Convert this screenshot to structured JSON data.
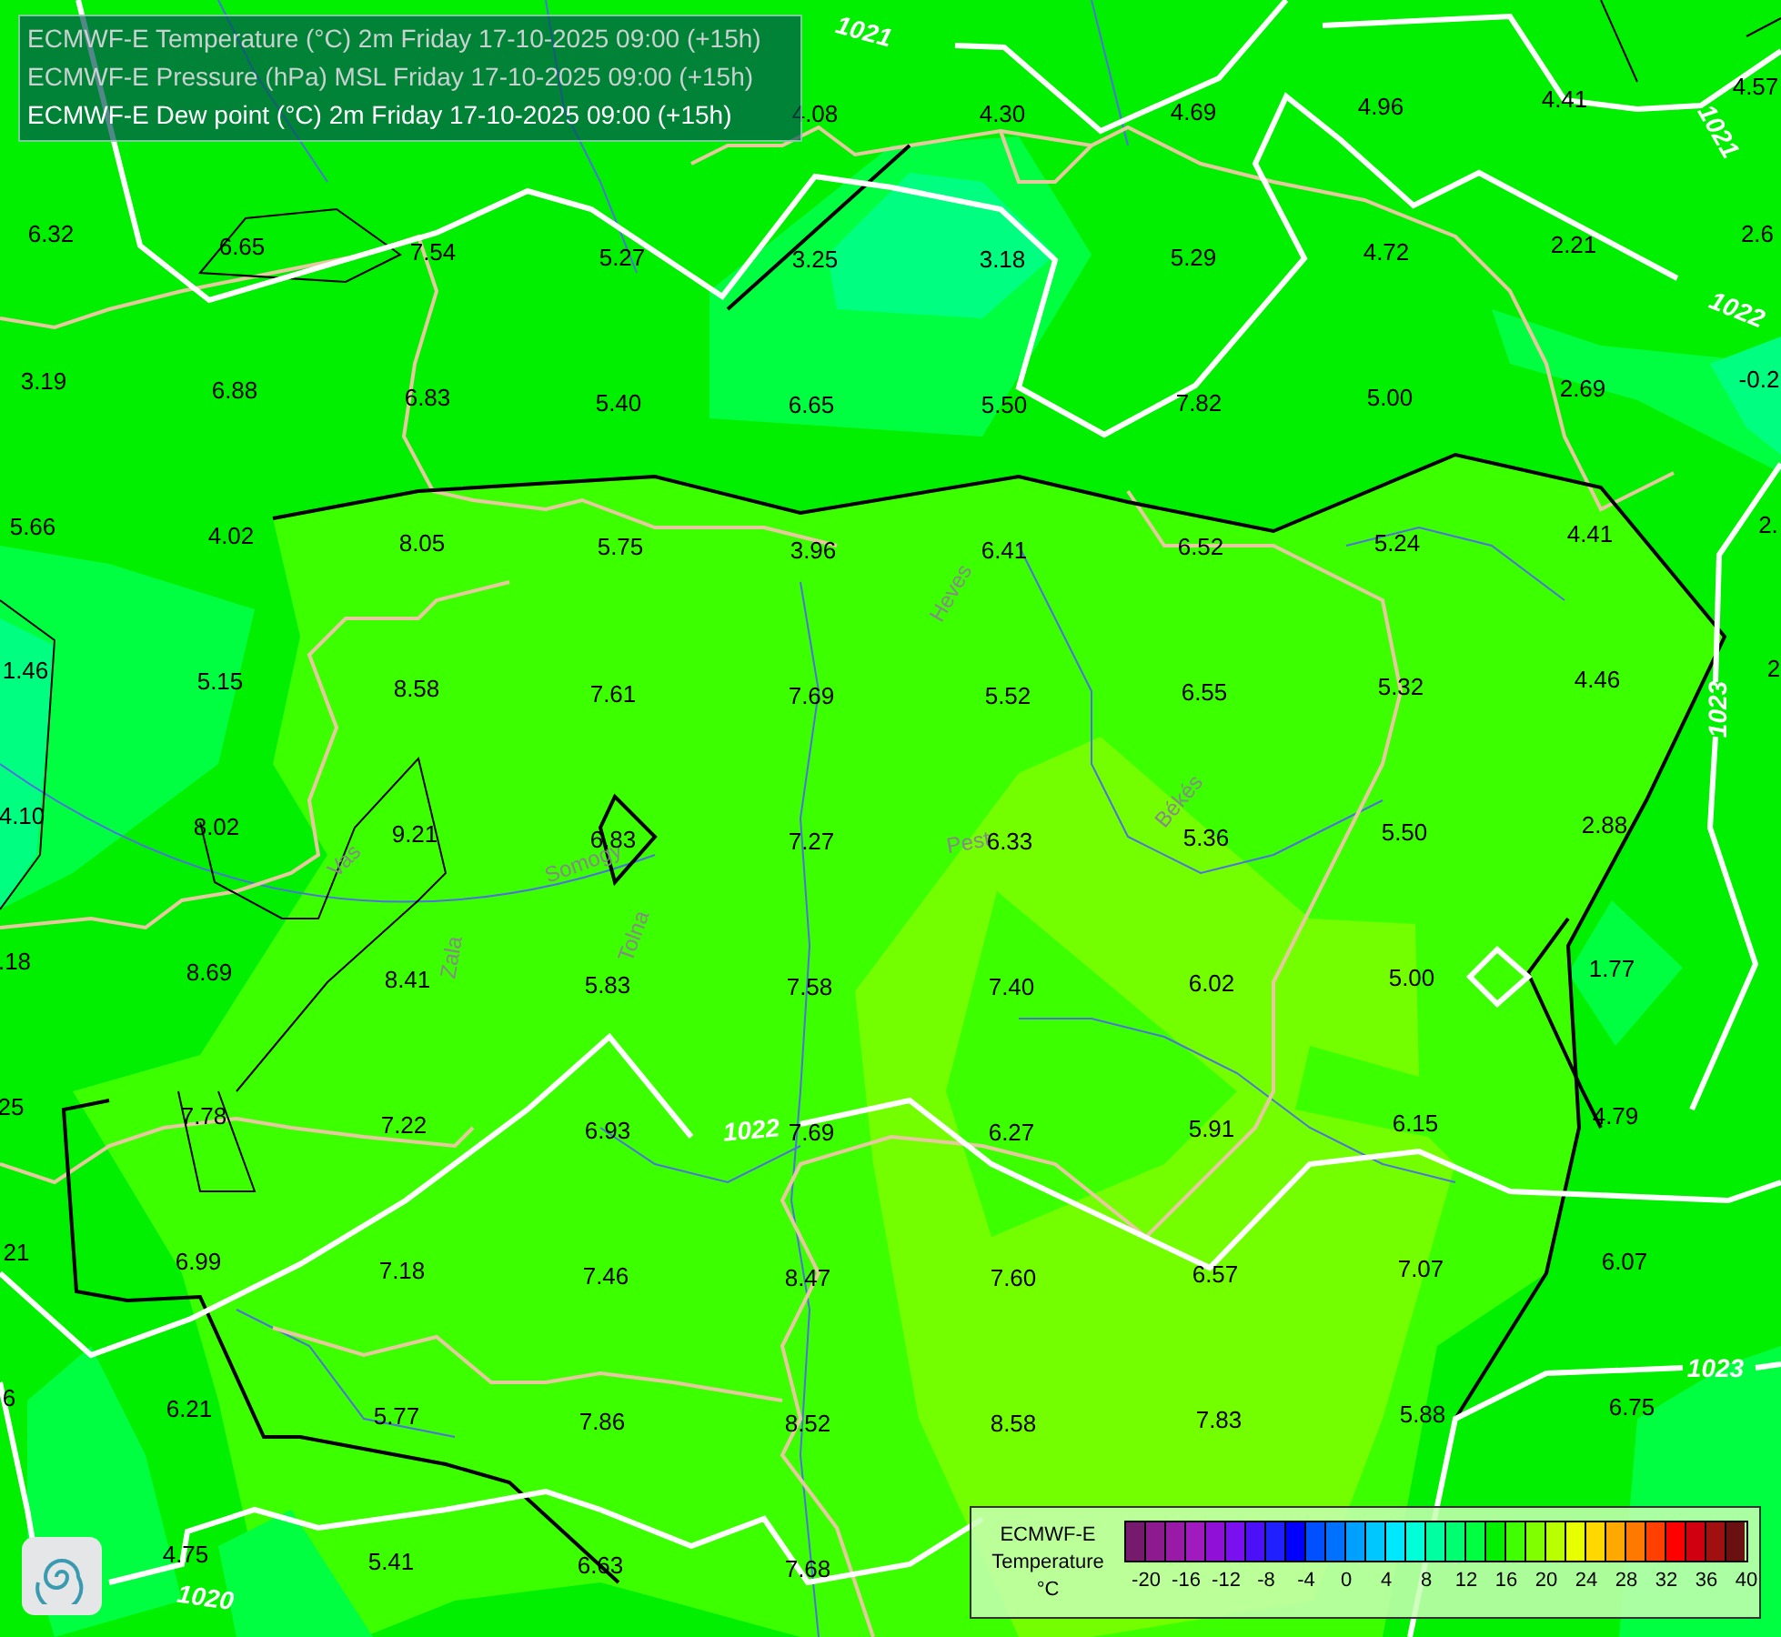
{
  "header": {
    "lines": [
      {
        "text": "ECMWF-E Temperature (°C) 2m Friday 17-10-2025 09:00 (+15h)",
        "selected": false
      },
      {
        "text": "ECMWF-E Pressure (hPa) MSL Friday 17-10-2025 09:00 (+15h)",
        "selected": false
      },
      {
        "text": "ECMWF-E Dew point (°C) 2m Friday 17-10-2025 09:00 (+15h)",
        "selected": true
      }
    ]
  },
  "values": [
    "4.08",
    "4.30",
    "4.69",
    "4.96",
    "4.41",
    "4.57",
    "6.32",
    "6.65",
    "7.54",
    "5.27",
    "3.25",
    "3.18",
    "5.29",
    "4.72",
    "2.21",
    "2.6",
    "3.19",
    "6.88",
    "6.83",
    "5.40",
    "6.65",
    "5.50",
    "7.82",
    "5.00",
    "2.69",
    "-0.2",
    "5.66",
    "4.02",
    "8.05",
    "5.75",
    "3.96",
    "6.41",
    "6.52",
    "5.24",
    "4.41",
    "2.",
    "1.46",
    "5.15",
    "8.58",
    "7.61",
    "7.69",
    "5.52",
    "6.55",
    "5.32",
    "4.46",
    "2",
    "4.10",
    "8.02",
    "9.21",
    "6.83",
    "7.27",
    "6.33",
    "5.36",
    "5.50",
    "2.88",
    ".18",
    "8.69",
    "8.41",
    "5.83",
    "7.58",
    "7.40",
    "6.02",
    "5.00",
    "1.77",
    "25",
    "7.78",
    "7.22",
    "6.93",
    "7.69",
    "6.27",
    "5.91",
    "6.15",
    "4.79",
    "21",
    "6.99",
    "7.18",
    "7.46",
    "8.47",
    "7.60",
    "6.57",
    "7.07",
    "6.07",
    "6",
    "6.21",
    "5.77",
    "7.86",
    "8.52",
    "8.58",
    "7.83",
    "5.88",
    "6.75",
    "4.75",
    "5.41",
    "6.63",
    "7.68"
  ],
  "isobar_labels": [
    "1021",
    "1021",
    "1022",
    "1023",
    "1022",
    "1023",
    "1020"
  ],
  "region_labels": [
    "Vas",
    "Zala",
    "Somogy",
    "Tolna",
    "Heves",
    "Pest",
    "Békés"
  ],
  "legend": {
    "title": "ECMWF-E",
    "subtitle": "Temperature",
    "unit": "°C",
    "ticks": [
      "-20",
      "-16",
      "-12",
      "-8",
      "-4",
      "0",
      "4",
      "8",
      "12",
      "16",
      "20",
      "24",
      "28",
      "32",
      "36",
      "40"
    ]
  }
}
